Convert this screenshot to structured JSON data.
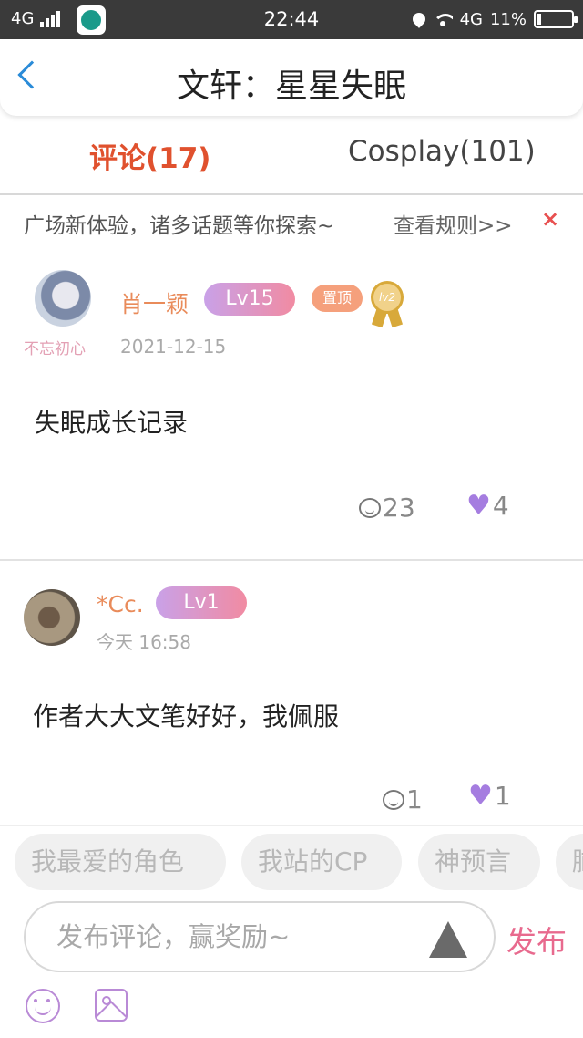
{
  "status_bar": {
    "network": "4G",
    "time": "22:44",
    "network_right": "4G",
    "battery": "11%",
    "battery_level": 0.11
  },
  "header": {
    "title": "文轩：星星失眠"
  },
  "tabs": [
    {
      "label": "评论(17)",
      "active": true
    },
    {
      "label": "Cosplay(101)",
      "active": false
    }
  ],
  "notice": {
    "text": "广场新体验，诸多话题等你探索~",
    "link": "查看规则>>",
    "close": "×"
  },
  "posts": [
    {
      "username": "肖一颖",
      "tagline": "不忘初心",
      "level": "Lv15",
      "pinned": "置顶",
      "medal": "lv2",
      "date": "2021-12-15",
      "content": "失眠成长记录",
      "comments": "23",
      "likes": "4"
    },
    {
      "username": "*Cc.",
      "level": "Lv1",
      "date": "今天 16:58",
      "content": "作者大大文笔好好，我佩服",
      "comments": "1",
      "likes": "1"
    }
  ],
  "topics": [
    "我最爱的角色",
    "我站的CP",
    "神预言",
    "脑"
  ],
  "composer": {
    "placeholder": "发布评论，赢奖励~",
    "publish": "发布"
  },
  "colors": {
    "accent": "#e0512e",
    "back": "#2a8bd8",
    "username": "#e98b5a",
    "heart": "#a57de0",
    "publish": "#e86a8e"
  },
  "icons": [
    "back-arrow-icon",
    "close-icon",
    "comment-bubble-icon",
    "heart-icon",
    "smile-icon",
    "image-icon",
    "send-arrow-icon",
    "medal-icon"
  ]
}
